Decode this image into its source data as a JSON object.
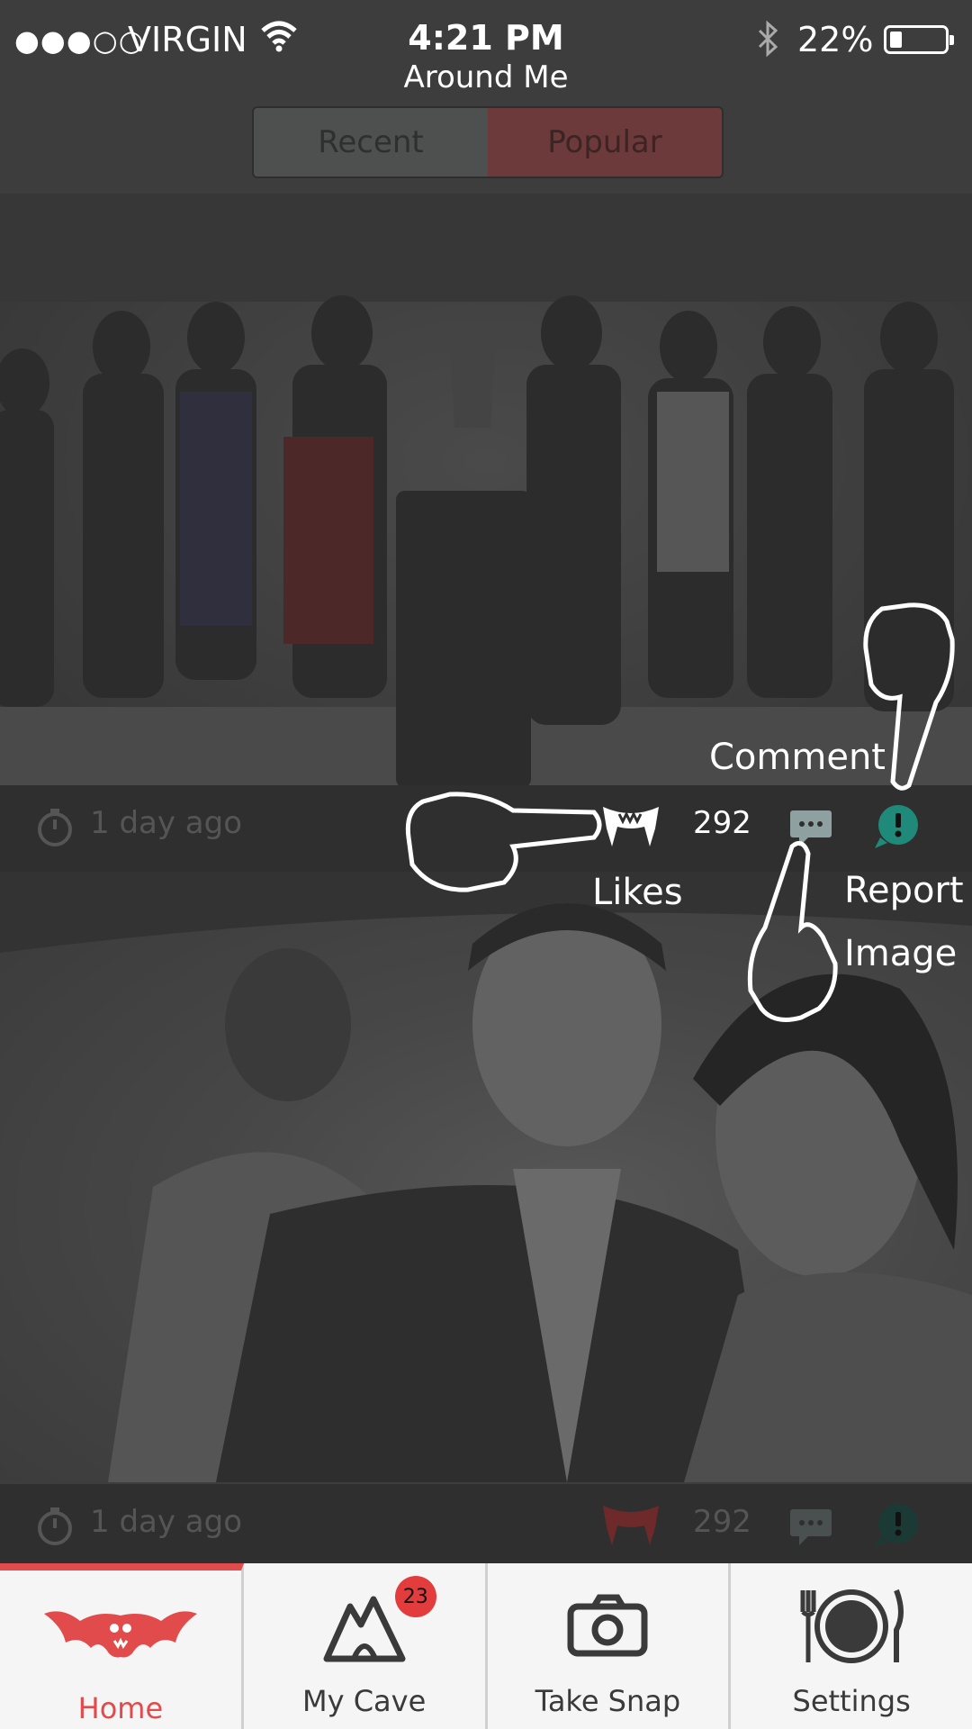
{
  "status_bar": {
    "signal": "●●●○○",
    "carrier": "VIRGIN",
    "time": "4:21 PM",
    "battery_percent": "22%",
    "battery_level": 0.22
  },
  "header": {
    "title": "Around Me",
    "tabs": [
      {
        "label": "Recent",
        "selected": false
      },
      {
        "label": "Popular",
        "selected": true
      }
    ]
  },
  "feed": [
    {
      "time_ago": "1 day ago",
      "likes": "292"
    },
    {
      "time_ago": "1 day ago",
      "likes": "292"
    }
  ],
  "tutorial_hints": {
    "comment": "Comment",
    "likes": "Likes",
    "report_line1": "Report",
    "report_line2": "Image"
  },
  "tab_bar": {
    "items": [
      {
        "label": "Home",
        "active": true
      },
      {
        "label": "My Cave",
        "badge": "23"
      },
      {
        "label": "Take Snap"
      },
      {
        "label": "Settings"
      }
    ]
  },
  "colors": {
    "accent": "#e14b4b",
    "report": "#1f8a7a",
    "background": "#3d3d3d"
  }
}
